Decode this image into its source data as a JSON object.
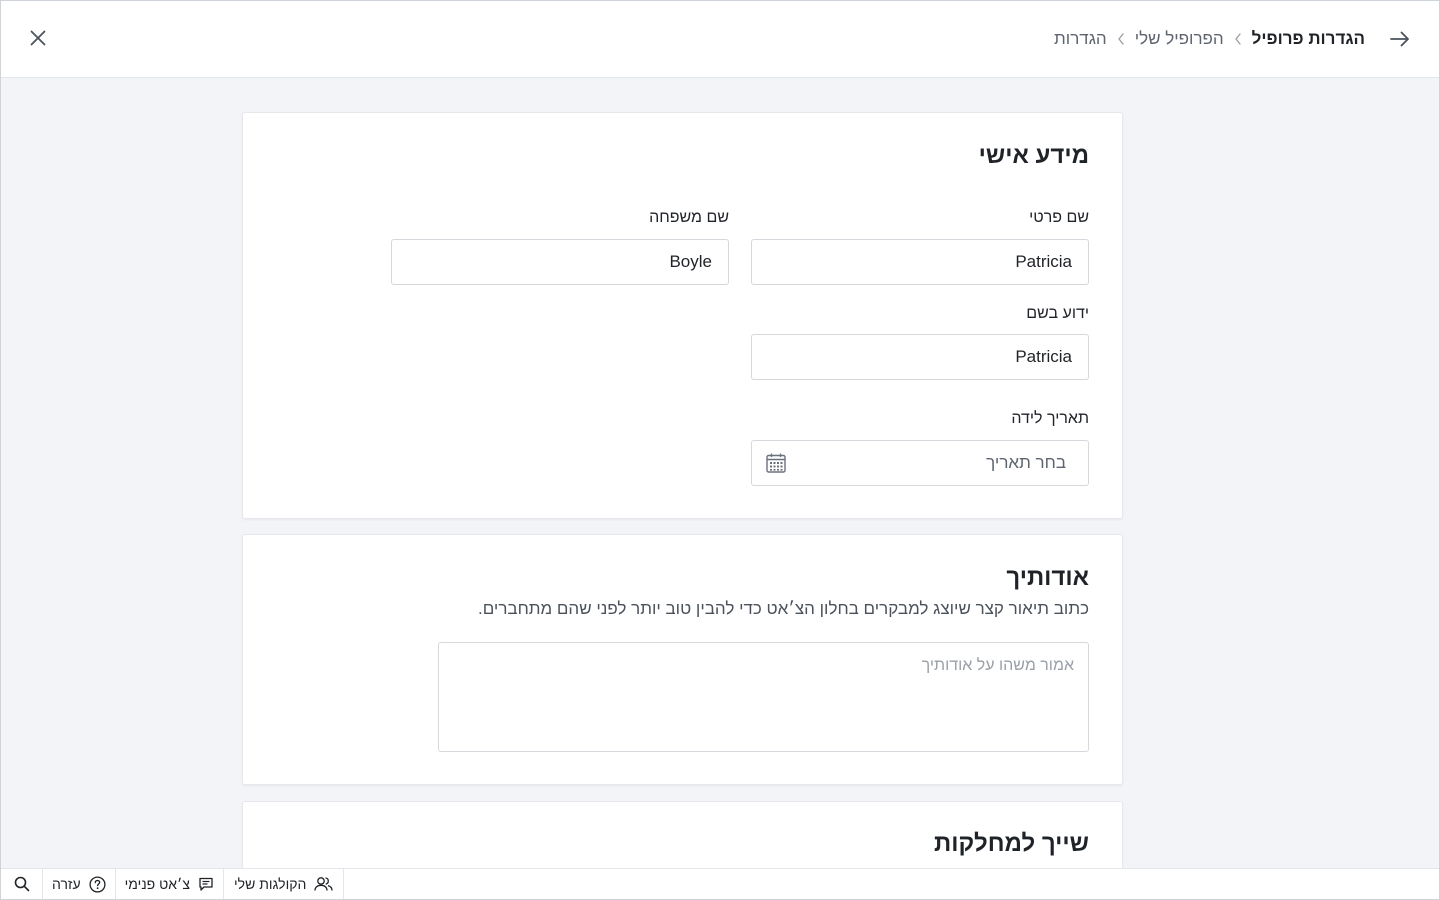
{
  "header": {
    "close_icon": "close-icon",
    "back_icon": "arrow-right-icon",
    "breadcrumb": [
      {
        "label": "הגדרות"
      },
      {
        "label": "הפרופיל שלי"
      },
      {
        "label": "הגדרות פרופיל"
      }
    ]
  },
  "personal": {
    "title": "מידע אישי",
    "first_name": {
      "label": "שם פרטי",
      "value": "Patricia"
    },
    "last_name": {
      "label": "שם משפחה",
      "value": "Boyle"
    },
    "known_as": {
      "label": "ידוע בשם",
      "value": "Patricia"
    },
    "birth_date": {
      "label": "תאריך לידה",
      "placeholder": "בחר תאריך",
      "icon": "calendar-icon"
    }
  },
  "about": {
    "title": "אודותיך",
    "description": "כתוב תיאור קצר שיוצג למבקרים בחלון הצ׳אט כדי להבין טוב יותר לפני שהם מתחברים.",
    "placeholder": "אמור משהו על אודותיך"
  },
  "departments": {
    "title": "שייך למחלקות"
  },
  "footer": {
    "search_icon": "search-icon",
    "help_label": "עזרה",
    "internal_chat_label": "צ׳אט פנימי",
    "my_colleagues_label": "הקולגות שלי"
  },
  "colors": {
    "background": "#f3f4f8",
    "card": "#ffffff",
    "border": "#d5d8dd",
    "text": "#1f2328",
    "muted": "#5d6470"
  }
}
